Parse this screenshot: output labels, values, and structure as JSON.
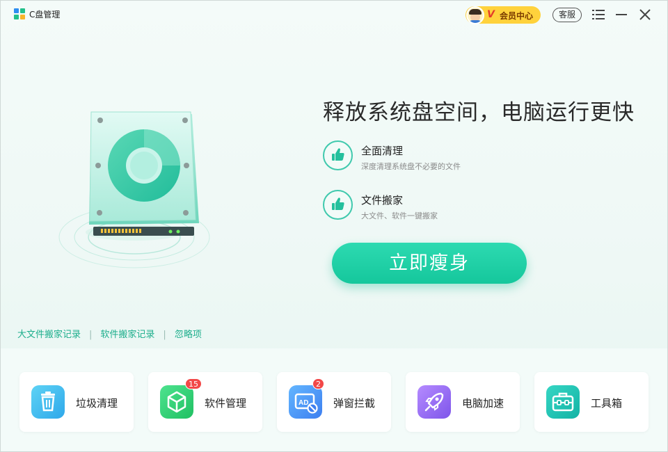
{
  "window": {
    "title": "C盘管理"
  },
  "header": {
    "vip_badge": "V",
    "vip_label": "会员中心",
    "service_label": "客服",
    "menu_icon": "menu-icon",
    "minimize_icon": "minimize-icon",
    "close_icon": "close-icon"
  },
  "hero": {
    "headline": "释放系统盘空间，电脑运行更快",
    "features": [
      {
        "title": "全面清理",
        "desc": "深度清理系统盘不必要的文件",
        "icon": "thumbs-up-icon"
      },
      {
        "title": "文件搬家",
        "desc": "大文件、软件一键搬家",
        "icon": "thumbs-up-icon"
      }
    ],
    "cta_label": "立即瘦身"
  },
  "links": [
    {
      "label": "大文件搬家记录"
    },
    {
      "label": "软件搬家记录"
    },
    {
      "label": "忽略项"
    }
  ],
  "tools": [
    {
      "label": "垃圾清理",
      "icon": "trash-icon",
      "badge": ""
    },
    {
      "label": "软件管理",
      "icon": "cube-icon",
      "badge": "15"
    },
    {
      "label": "弹窗拦截",
      "icon": "ad-block-icon",
      "badge": "2"
    },
    {
      "label": "电脑加速",
      "icon": "rocket-icon",
      "badge": ""
    },
    {
      "label": "工具箱",
      "icon": "toolbox-icon",
      "badge": ""
    }
  ],
  "colors": {
    "accent": "#1fcca3",
    "link": "#1cae8c",
    "badge": "#f24848",
    "vip": "#ffd23c"
  }
}
